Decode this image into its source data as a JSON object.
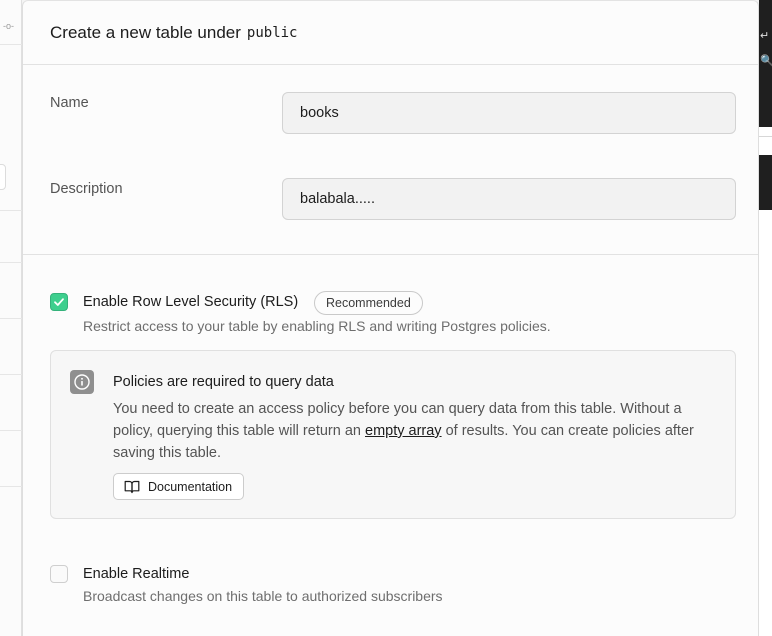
{
  "header": {
    "title": "Create a new table under",
    "schema": "public"
  },
  "name_field": {
    "label": "Name",
    "value": "books"
  },
  "description_field": {
    "label": "Description",
    "value": "balabala....."
  },
  "rls": {
    "checked": true,
    "title": "Enable Row Level Security (RLS)",
    "badge": "Recommended",
    "description": "Restrict access to your table by enabling RLS and writing Postgres policies."
  },
  "callout": {
    "icon": "info-icon",
    "title": "Policies are required to query data",
    "body_before": "You need to create an access policy before you can query data from this table. Without a policy, querying this table will return an ",
    "link": "empty array",
    "body_after": " of results. You can create policies after saving this table.",
    "button_label": "Documentation",
    "button_icon": "book-open-icon"
  },
  "realtime": {
    "checked": false,
    "title": "Enable Realtime",
    "description": "Broadcast changes on this table to authorized subscribers"
  },
  "colors": {
    "accent": "#3ecf8e",
    "panel_bg": "#fcfcfc",
    "input_bg": "#f2f2f2"
  }
}
